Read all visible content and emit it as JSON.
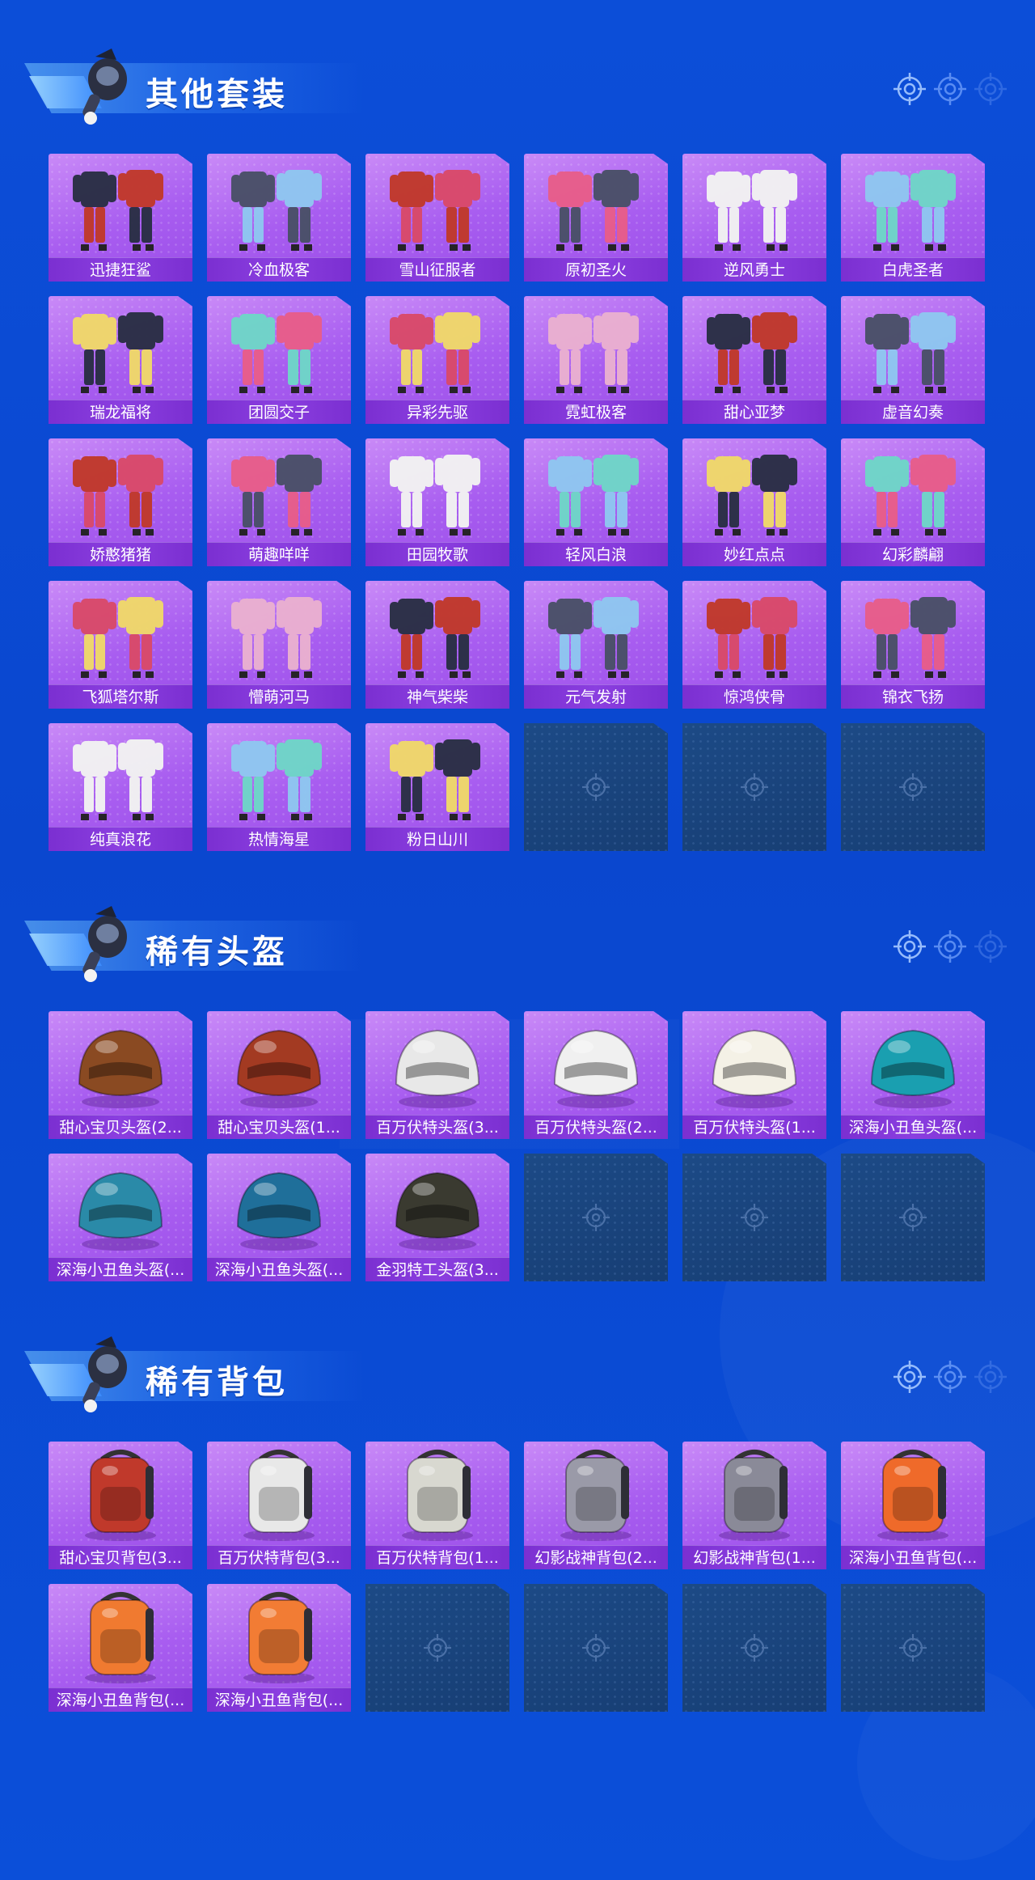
{
  "sections": [
    {
      "title": "其他套装",
      "items": [
        {
          "label": "迅捷狂鲨",
          "icon": "outfit-icon"
        },
        {
          "label": "冷血极客",
          "icon": "outfit-icon"
        },
        {
          "label": "雪山征服者",
          "icon": "outfit-icon"
        },
        {
          "label": "原初圣火",
          "icon": "outfit-icon"
        },
        {
          "label": "逆风勇士",
          "icon": "outfit-icon"
        },
        {
          "label": "白虎圣者",
          "icon": "outfit-icon"
        },
        {
          "label": "瑞龙福将",
          "icon": "outfit-icon"
        },
        {
          "label": "团圆交子",
          "icon": "outfit-icon"
        },
        {
          "label": "异彩先驱",
          "icon": "outfit-icon"
        },
        {
          "label": "霓虹极客",
          "icon": "outfit-icon"
        },
        {
          "label": "甜心亚梦",
          "icon": "outfit-icon"
        },
        {
          "label": "虚音幻奏",
          "icon": "outfit-icon"
        },
        {
          "label": "娇憨猪猪",
          "icon": "outfit-icon"
        },
        {
          "label": "萌趣咩咩",
          "icon": "outfit-icon"
        },
        {
          "label": "田园牧歌",
          "icon": "outfit-icon"
        },
        {
          "label": "轻风白浪",
          "icon": "outfit-icon"
        },
        {
          "label": "妙红点点",
          "icon": "outfit-icon"
        },
        {
          "label": "幻彩麟翩",
          "icon": "outfit-icon"
        },
        {
          "label": "飞狐塔尔斯",
          "icon": "outfit-icon"
        },
        {
          "label": "懵萌河马",
          "icon": "outfit-icon"
        },
        {
          "label": "神气柴柴",
          "icon": "outfit-icon"
        },
        {
          "label": "元气发射",
          "icon": "outfit-icon"
        },
        {
          "label": "惊鸿侠骨",
          "icon": "outfit-icon"
        },
        {
          "label": "锦衣飞扬",
          "icon": "outfit-icon"
        },
        {
          "label": "纯真浪花",
          "icon": "outfit-icon"
        },
        {
          "label": "热情海星",
          "icon": "outfit-icon"
        },
        {
          "label": "粉日山川",
          "icon": "outfit-icon"
        }
      ],
      "empty_slots": 3
    },
    {
      "title": "稀有头盔",
      "items": [
        {
          "label": "甜心宝贝头盔(2...",
          "icon": "helmet-icon",
          "color": "#8a4a22"
        },
        {
          "label": "甜心宝贝头盔(1...",
          "icon": "helmet-icon",
          "color": "#a33a22"
        },
        {
          "label": "百万伏特头盔(3...",
          "icon": "helmet-icon",
          "color": "#e8e8e8"
        },
        {
          "label": "百万伏特头盔(2...",
          "icon": "helmet-icon",
          "color": "#f0f0f0"
        },
        {
          "label": "百万伏特头盔(1...",
          "icon": "helmet-icon",
          "color": "#f4f1e6"
        },
        {
          "label": "深海小丑鱼头盔(...",
          "icon": "helmet-icon",
          "color": "#1a9fb0"
        },
        {
          "label": "深海小丑鱼头盔(...",
          "icon": "helmet-icon",
          "color": "#2a8aa8"
        },
        {
          "label": "深海小丑鱼头盔(...",
          "icon": "helmet-icon",
          "color": "#1f6f9a"
        },
        {
          "label": "金羽特工头盔(3...",
          "icon": "helmet-icon",
          "color": "#3a3a30"
        }
      ],
      "empty_slots": 3
    },
    {
      "title": "稀有背包",
      "items": [
        {
          "label": "甜心宝贝背包(3...",
          "icon": "backpack-icon",
          "color": "#c0392b"
        },
        {
          "label": "百万伏特背包(3...",
          "icon": "backpack-icon",
          "color": "#e8e8e8"
        },
        {
          "label": "百万伏特背包(1...",
          "icon": "backpack-icon",
          "color": "#d8d8d0"
        },
        {
          "label": "幻影战神背包(2...",
          "icon": "backpack-icon",
          "color": "#9a9aa8"
        },
        {
          "label": "幻影战神背包(1...",
          "icon": "backpack-icon",
          "color": "#8a8a98"
        },
        {
          "label": "深海小丑鱼背包(...",
          "icon": "backpack-icon",
          "color": "#ef6a2a"
        },
        {
          "label": "深海小丑鱼背包(...",
          "icon": "backpack-icon",
          "color": "#f07a30"
        },
        {
          "label": "深海小丑鱼背包(...",
          "icon": "backpack-icon",
          "color": "#f27c34"
        }
      ],
      "empty_slots": 4
    }
  ],
  "colors": {
    "background": "#0b4ed6",
    "card_purple": "#a85df0",
    "label_bar": "#7b2fd1",
    "empty_slot": "#1a4580"
  }
}
